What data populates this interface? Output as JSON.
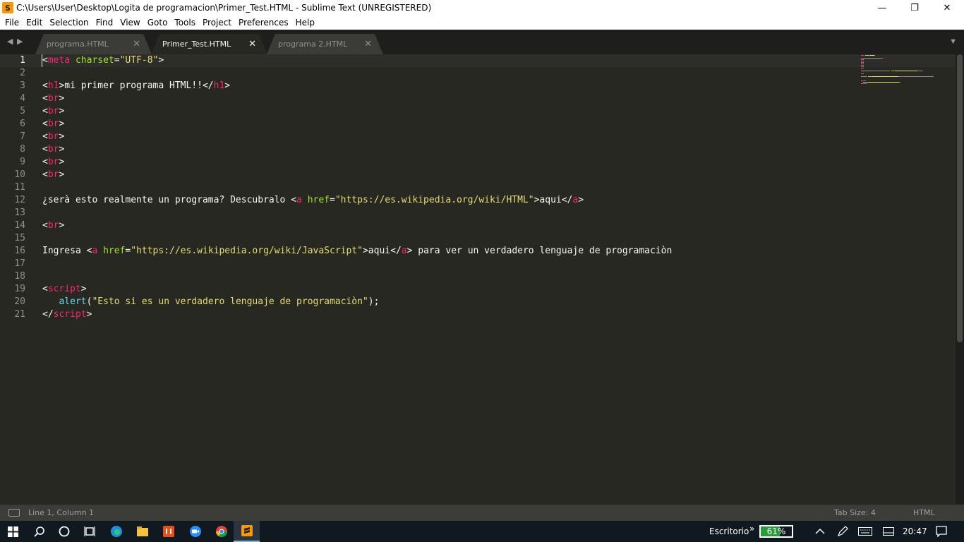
{
  "window": {
    "title": "C:\\Users\\User\\Desktop\\Logita de programacion\\Primer_Test.HTML - Sublime Text (UNREGISTERED)",
    "icon_letter": "S",
    "minimize_glyph": "—",
    "maximize_glyph": "❐",
    "close_glyph": "✕"
  },
  "menu": [
    "File",
    "Edit",
    "Selection",
    "Find",
    "View",
    "Goto",
    "Tools",
    "Project",
    "Preferences",
    "Help"
  ],
  "tabs": [
    {
      "label": "programa.HTML",
      "active": false
    },
    {
      "label": "Primer_Test.HTML",
      "active": true
    },
    {
      "label": "programa 2.HTML",
      "active": false
    }
  ],
  "tab_close_glyph": "✕",
  "tab_nav": {
    "left": "◀",
    "right": "▶",
    "dropdown": "▼"
  },
  "editor": {
    "line_numbers": [
      "1",
      "2",
      "3",
      "4",
      "5",
      "6",
      "7",
      "8",
      "9",
      "10",
      "11",
      "12",
      "13",
      "14",
      "15",
      "16",
      "17",
      "18",
      "19",
      "20",
      "21"
    ],
    "lines": [
      [
        {
          "t": "<"
        },
        {
          "t": "meta",
          "c": "tag"
        },
        {
          "t": " "
        },
        {
          "t": "charset",
          "c": "attr"
        },
        {
          "t": "="
        },
        {
          "t": "\"UTF-8\"",
          "c": "str"
        },
        {
          "t": ">"
        }
      ],
      [],
      [
        {
          "t": "<"
        },
        {
          "t": "h1",
          "c": "tag"
        },
        {
          "t": ">mi primer programa HTML!!</"
        },
        {
          "t": "h1",
          "c": "tag"
        },
        {
          "t": ">"
        }
      ],
      [
        {
          "t": "<"
        },
        {
          "t": "br",
          "c": "tag"
        },
        {
          "t": ">"
        }
      ],
      [
        {
          "t": "<"
        },
        {
          "t": "br",
          "c": "tag"
        },
        {
          "t": ">"
        }
      ],
      [
        {
          "t": "<"
        },
        {
          "t": "br",
          "c": "tag"
        },
        {
          "t": ">"
        }
      ],
      [
        {
          "t": "<"
        },
        {
          "t": "br",
          "c": "tag"
        },
        {
          "t": ">"
        }
      ],
      [
        {
          "t": "<"
        },
        {
          "t": "br",
          "c": "tag"
        },
        {
          "t": ">"
        }
      ],
      [
        {
          "t": "<"
        },
        {
          "t": "br",
          "c": "tag"
        },
        {
          "t": ">"
        }
      ],
      [
        {
          "t": "<"
        },
        {
          "t": "br",
          "c": "tag"
        },
        {
          "t": ">"
        }
      ],
      [],
      [
        {
          "t": "¿serà esto realmente un programa? Descubralo <"
        },
        {
          "t": "a",
          "c": "tag"
        },
        {
          "t": " "
        },
        {
          "t": "href",
          "c": "attr"
        },
        {
          "t": "="
        },
        {
          "t": "\"https://es.wikipedia.org/wiki/HTML\"",
          "c": "str"
        },
        {
          "t": ">aqui</"
        },
        {
          "t": "a",
          "c": "tag"
        },
        {
          "t": ">"
        }
      ],
      [],
      [
        {
          "t": "<"
        },
        {
          "t": "br",
          "c": "tag"
        },
        {
          "t": ">"
        }
      ],
      [],
      [
        {
          "t": "Ingresa <"
        },
        {
          "t": "a",
          "c": "tag"
        },
        {
          "t": " "
        },
        {
          "t": "href",
          "c": "attr"
        },
        {
          "t": "="
        },
        {
          "t": "\"https://es.wikipedia.org/wiki/JavaScript\"",
          "c": "str"
        },
        {
          "t": ">aqui</"
        },
        {
          "t": "a",
          "c": "tag"
        },
        {
          "t": "> para ver un verdadero lenguaje de programaciòn"
        }
      ],
      [],
      [],
      [
        {
          "t": "<"
        },
        {
          "t": "script",
          "c": "tag"
        },
        {
          "t": ">"
        }
      ],
      [
        {
          "t": "   "
        },
        {
          "t": "alert",
          "c": "fn"
        },
        {
          "t": "("
        },
        {
          "t": "\"Esto si es un verdadero lenguaje de programaciòn\"",
          "c": "str"
        },
        {
          "t": ");"
        }
      ],
      [
        {
          "t": "</"
        },
        {
          "t": "script",
          "c": "tag"
        },
        {
          "t": ">"
        }
      ]
    ]
  },
  "status": {
    "position": "Line 1, Column 1",
    "tab_size": "Tab Size: 4",
    "syntax": "HTML"
  },
  "taskbar": {
    "desktop_label": "Escritorio",
    "chevron": "»",
    "battery_percent": 61,
    "battery_text": "61%",
    "clock": "20:47",
    "icons": [
      "windows-start-icon",
      "search-icon",
      "cortana-icon",
      "task-view-icon",
      "edge-icon",
      "file-explorer-icon",
      "office-icon",
      "zoom-icon",
      "chrome-icon",
      "sublime-text-icon"
    ]
  }
}
